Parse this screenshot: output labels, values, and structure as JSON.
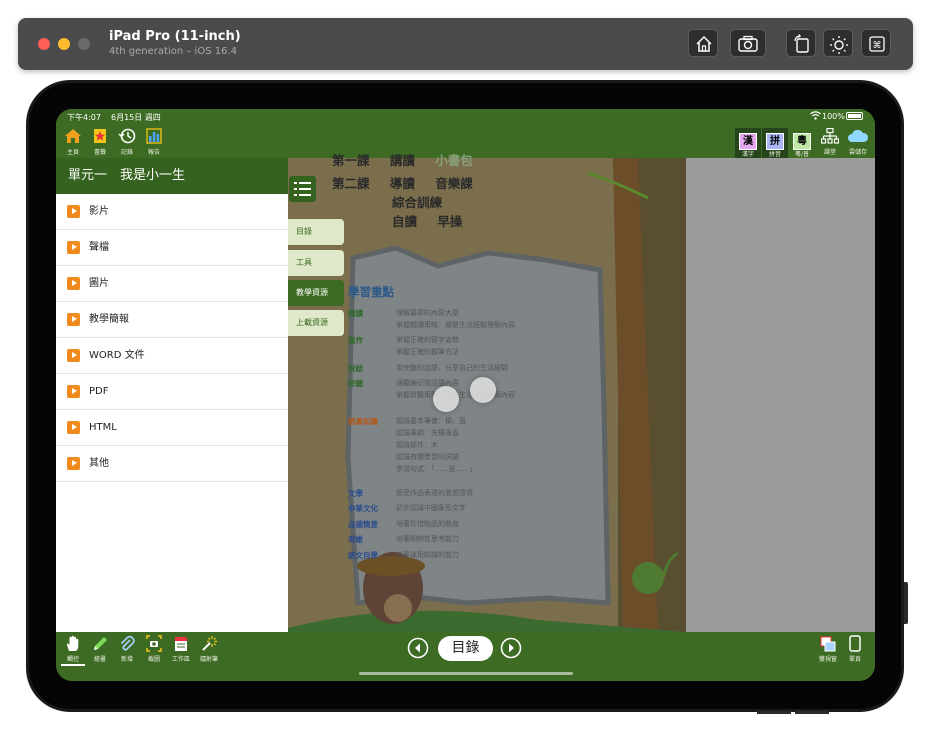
{
  "simulator": {
    "title": "iPad Pro (11-inch)",
    "subtitle": "4th generation – iOS 16.4",
    "buttons": [
      "home-icon",
      "screenshot-icon",
      "rotate-icon",
      "brightness-icon",
      "command-icon"
    ]
  },
  "status_bar": {
    "time": "下午4:07",
    "date": "6月15日 週四",
    "battery": "100%"
  },
  "top_toolbar": {
    "left": [
      {
        "label": "主頁",
        "icon": "home-icon",
        "color": "#f0a020"
      },
      {
        "label": "書籤",
        "icon": "bookmark-icon",
        "color": "#e8343c"
      },
      {
        "label": "記錄",
        "icon": "history-icon",
        "color": "#ffffff"
      },
      {
        "label": "報告",
        "icon": "chart-icon",
        "color": "#f5c518"
      }
    ],
    "right": [
      {
        "label": "漢字",
        "glyph": "漢",
        "color": "#c23bd4"
      },
      {
        "label": "拼音",
        "glyph": "拼",
        "color": "#3b4cd4"
      },
      {
        "label": "粵/普",
        "glyph": "粵",
        "color": "#3aa84a"
      },
      {
        "label": "課堂",
        "icon": "hierarchy-icon",
        "color": "#ffffff"
      },
      {
        "label": "雲儲存",
        "icon": "cloud-icon",
        "color": "#8fd8ff"
      }
    ]
  },
  "sidebar": {
    "header": "單元一　我是小一生",
    "items": [
      {
        "label": "影片"
      },
      {
        "label": "聲檔"
      },
      {
        "label": "圖片"
      },
      {
        "label": "教學簡報"
      },
      {
        "label": "WORD 文件"
      },
      {
        "label": "PDF"
      },
      {
        "label": "HTML"
      },
      {
        "label": "其他"
      }
    ]
  },
  "side_tabs": {
    "items": [
      {
        "label": "目錄",
        "active": false
      },
      {
        "label": "工具",
        "active": false
      },
      {
        "label": "教學資源",
        "active": true
      },
      {
        "label": "上載資源",
        "active": false
      }
    ]
  },
  "book_page": {
    "lessons": [
      {
        "lesson": "第一課",
        "type": "講讀",
        "title": "小書包"
      },
      {
        "lesson": "第二課",
        "type": "導讀",
        "title": "音樂課"
      },
      {
        "lesson": "",
        "type": "綜合訓練",
        "title": ""
      },
      {
        "lesson": "",
        "type": "自讀",
        "title": "早操"
      }
    ],
    "section_title": "學習重點",
    "points": [
      {
        "category": "閱讀",
        "color": "green",
        "lines": [
          "理解篇章的內容大意",
          "掌握閱讀策略：聯繫生活經驗理解內容"
        ]
      },
      {
        "category": "寫作",
        "color": "green",
        "lines": [
          "掌握正確的寫字姿勢",
          "掌握正確的握筆方法"
        ]
      },
      {
        "category": "說話",
        "color": "green",
        "lines": [
          "用完整的話語，分享自己的生活經驗"
        ]
      },
      {
        "category": "聆聽",
        "color": "green",
        "lines": [
          "通聽遍記憶話語內容",
          "掌握聆聽策略：聯繫生活經驗理解內容"
        ]
      },
      {
        "category": "語基知識",
        "color": "orange",
        "lines": [
          "認識基本筆畫：橫、直",
          "認識筆順：先橫後直",
          "認識部件：木",
          "認識有關學習的詞語",
          "學習句式：「……是……」"
        ]
      },
      {
        "category": "文學",
        "color": "blue",
        "lines": [
          "感受作品表達的思想感情"
        ]
      },
      {
        "category": "中華文化",
        "color": "blue",
        "lines": [
          "初步認識中國象形文字"
        ]
      },
      {
        "category": "品德情意",
        "color": "blue",
        "lines": [
          "培養珍惜物品的態度"
        ]
      },
      {
        "category": "思維",
        "color": "blue",
        "lines": [
          "培養明辨性思考能力"
        ]
      },
      {
        "category": "語文自學",
        "color": "blue",
        "lines": [
          "培養運用知識的能力"
        ]
      }
    ]
  },
  "bottom_toolbar": {
    "left": [
      {
        "label": "觸控",
        "icon": "hand-icon"
      },
      {
        "label": "繪畫",
        "icon": "pencil-icon"
      },
      {
        "label": "新增",
        "icon": "paperclip-icon"
      },
      {
        "label": "截圖",
        "icon": "screenshot-icon"
      },
      {
        "label": "工作區",
        "icon": "worksheet-icon"
      },
      {
        "label": "鐳射筆",
        "icon": "laser-icon"
      }
    ],
    "center_label": "目錄",
    "right": [
      {
        "label": "雙視窗",
        "icon": "dual-window-icon"
      },
      {
        "label": "單頁",
        "icon": "single-page-icon"
      }
    ]
  }
}
